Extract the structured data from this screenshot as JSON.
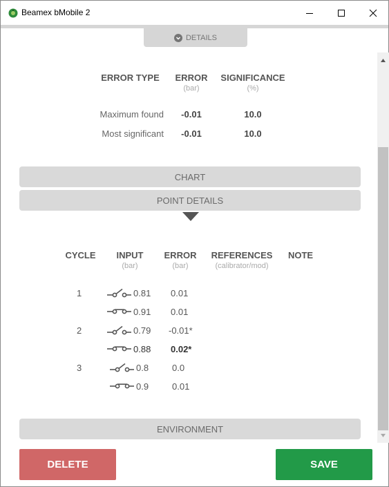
{
  "window": {
    "title": "Beamex bMobile 2"
  },
  "details_tab": {
    "label": "DETAILS"
  },
  "summary": {
    "headers": [
      {
        "label": "ERROR TYPE",
        "unit": ""
      },
      {
        "label": "ERROR",
        "unit": "(bar)"
      },
      {
        "label": "SIGNIFICANCE",
        "unit": "(%)"
      }
    ],
    "rows": [
      {
        "type": "Maximum found",
        "error": "-0.01",
        "significance": "10.0"
      },
      {
        "type": "Most significant",
        "error": "-0.01",
        "significance": "10.0"
      }
    ]
  },
  "sections": {
    "chart": "CHART",
    "point_details": "POINT DETAILS",
    "environment": "ENVIRONMENT"
  },
  "points": {
    "headers": [
      {
        "label": "CYCLE",
        "unit": ""
      },
      {
        "label": "INPUT",
        "unit": "(bar)"
      },
      {
        "label": "ERROR",
        "unit": "(bar)"
      },
      {
        "label": "REFERENCES",
        "unit": "(calibrator/mod)"
      },
      {
        "label": "NOTE",
        "unit": ""
      }
    ],
    "rows": [
      {
        "cycle": "1",
        "switch": "open",
        "input": "0.81",
        "error": "0.01",
        "highlight": false
      },
      {
        "cycle": "",
        "switch": "closed",
        "input": "0.91",
        "error": "0.01",
        "highlight": false
      },
      {
        "cycle": "2",
        "switch": "open",
        "input": "0.79",
        "error": "-0.01*",
        "highlight": false
      },
      {
        "cycle": "",
        "switch": "closed",
        "input": "0.88",
        "error": "0.02*",
        "highlight": true
      },
      {
        "cycle": "3",
        "switch": "open",
        "input": "0.8",
        "error": "0.0",
        "highlight": false
      },
      {
        "cycle": "",
        "switch": "closed",
        "input": "0.9",
        "error": "0.01",
        "highlight": false
      }
    ]
  },
  "actions": {
    "delete": "DELETE",
    "save": "SAVE"
  },
  "colors": {
    "delete": "#d06767",
    "save": "#229a48",
    "section": "#d9d9d9"
  }
}
